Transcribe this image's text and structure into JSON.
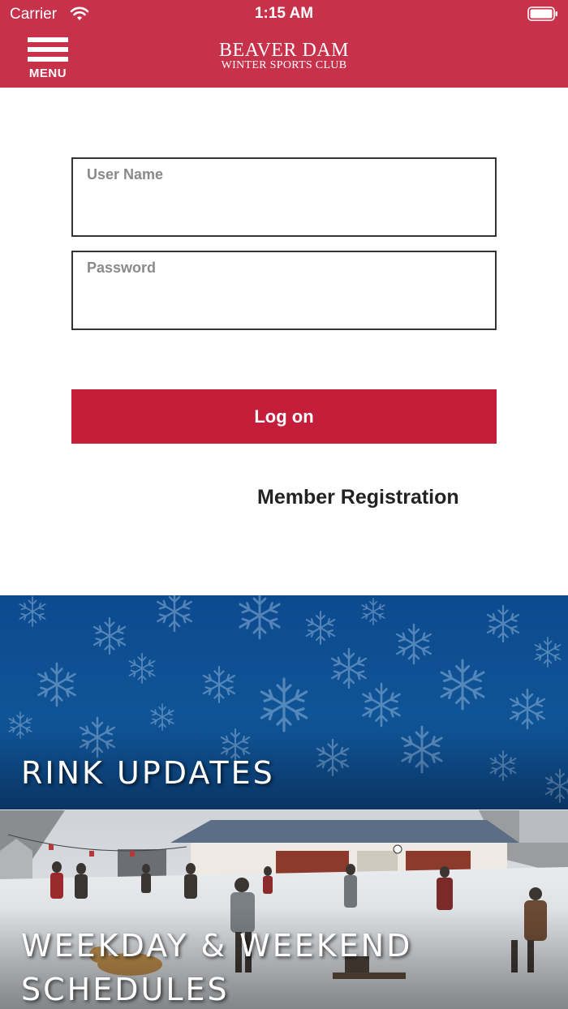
{
  "status_bar": {
    "carrier": "Carrier",
    "time": "1:15 AM",
    "wifi_icon": "wifi-icon",
    "battery_icon": "battery-full-icon"
  },
  "header": {
    "menu_label": "MENU",
    "menu_icon": "hamburger-menu-icon",
    "brand_line1": "BEAVER DAM",
    "brand_line2": "WINTER SPORTS CLUB",
    "background_color": "#c8314a"
  },
  "login": {
    "username_placeholder": "User Name",
    "username_value": "",
    "password_placeholder": "Password",
    "password_value": "",
    "logon_label": "Log on",
    "register_label": "Member Registration",
    "button_color": "#c41e3a"
  },
  "tiles": [
    {
      "title": "RINK UPDATES",
      "image": "blue-snowflake-background"
    },
    {
      "title_line1": "WEEKDAY & WEEKEND",
      "title_line2": "SCHEDULES",
      "image": "vintage-skating-rink-painting"
    }
  ]
}
